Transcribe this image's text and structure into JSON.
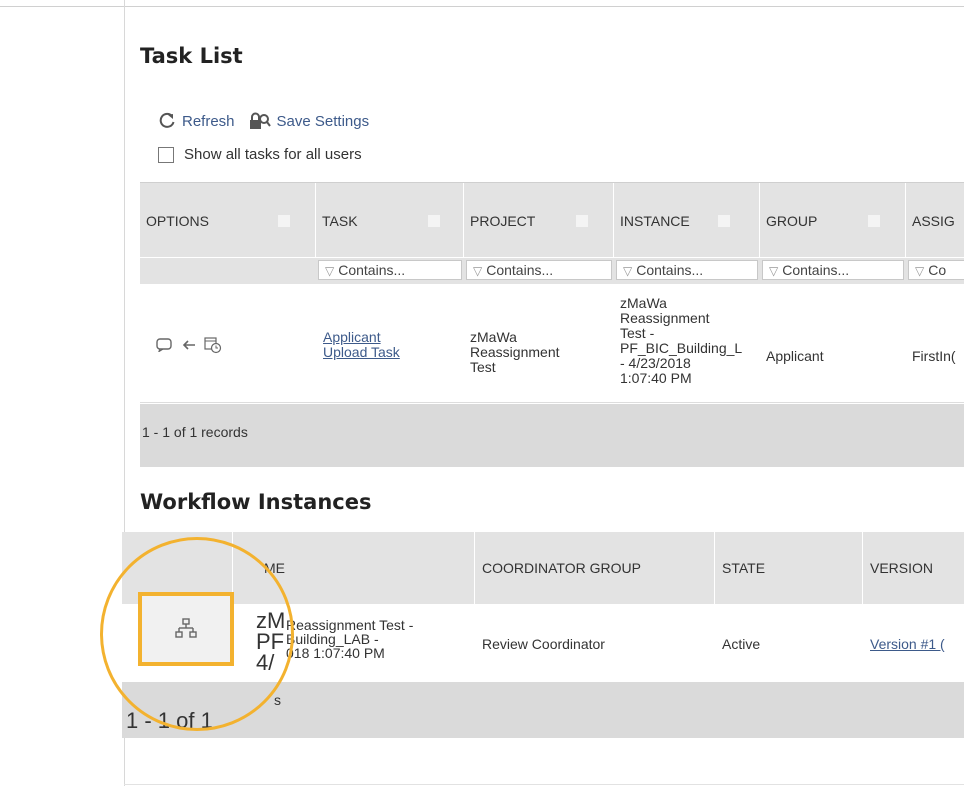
{
  "task_list": {
    "title": "Task List",
    "refresh_label": "Refresh",
    "save_settings_label": "Save Settings",
    "show_all_label": "Show all tasks for all users",
    "columns": [
      "OPTIONS",
      "TASK",
      "PROJECT",
      "INSTANCE",
      "GROUP",
      "ASSIG"
    ],
    "filter_placeholder": "Contains...",
    "filter_last": "Co",
    "row": {
      "task_line1": "Applicant",
      "task_line2": "Upload Task",
      "project": [
        "zMaWa",
        "Reassignment",
        "Test"
      ],
      "instance": [
        "zMaWa",
        "Reassignment",
        "Test -",
        "PF_BIC_Building_L",
        "- 4/23/2018",
        "1:07:40 PM"
      ],
      "group": "Applicant",
      "assignee": "FirstIn("
    },
    "records": "1 - 1 of 1 records"
  },
  "workflow": {
    "title": "Workflow Instances",
    "columns": {
      "name": "ME",
      "coordinator_group": "COORDINATOR GROUP",
      "state": "STATE",
      "version": "VERSION"
    },
    "row": {
      "name_big": [
        "zM",
        "PF",
        "4/"
      ],
      "name_small": [
        "Reassignment Test -",
        "Building_LAB -",
        "018 1:07:40 PM"
      ],
      "coordinator_group": "Review Coordinator",
      "state": "Active",
      "version": "Version #1 ("
    },
    "records_big": "1 - 1 of 1",
    "records_small": "s"
  },
  "icons": {
    "refresh": "refresh-icon",
    "save": "save-settings-icon",
    "hierarchy": "hierarchy-icon",
    "comment": "comment-icon",
    "reassign": "arrow-left-icon",
    "schedule": "calendar-clock-icon"
  },
  "colors": {
    "highlight": "#f3b22f",
    "link": "#3d5a8a",
    "header_bg": "#e3e3e3"
  }
}
